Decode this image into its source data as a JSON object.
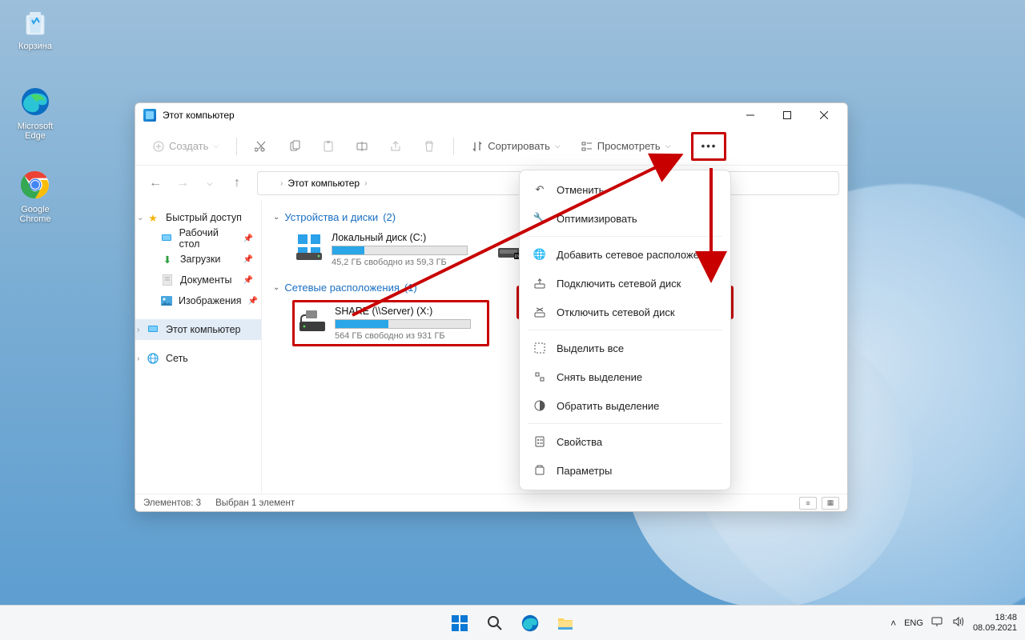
{
  "desktop": {
    "icons": [
      {
        "name": "recycle-bin",
        "label": "Корзина"
      },
      {
        "name": "edge",
        "label": "Microsoft Edge"
      },
      {
        "name": "chrome",
        "label": "Google Chrome"
      }
    ]
  },
  "window": {
    "title": "Этот компьютер",
    "toolbar": {
      "new": "Создать",
      "sort": "Сортировать",
      "view": "Просмотреть"
    },
    "breadcrumb": "Этот компьютер",
    "sidebar": {
      "quick": "Быстрый доступ",
      "desktop": "Рабочий стол",
      "downloads": "Загрузки",
      "documents": "Документы",
      "pictures": "Изображения",
      "thispc": "Этот компьютер",
      "network": "Сеть"
    },
    "groups": {
      "drives": {
        "title": "Устройства и диски",
        "count": "(2)"
      },
      "netloc": {
        "title": "Сетевые расположения",
        "count": "(1)"
      }
    },
    "drive_c": {
      "name": "Локальный диск (C:)",
      "free": "45,2 ГБ свободно из 59,3 ГБ",
      "fill_pct": 24
    },
    "drive_share": {
      "name": "SHARE (\\\\Server) (X:)",
      "free": "564 ГБ свободно из 931 ГБ",
      "fill_pct": 39
    },
    "status": {
      "items": "Элементов: 3",
      "selected": "Выбран 1 элемент"
    }
  },
  "ctxmenu": {
    "undo": "Отменить",
    "optimize": "Оптимизировать",
    "add_netloc": "Добавить сетевое расположение",
    "map_drive": "Подключить сетевой диск",
    "unmap_drive": "Отключить сетевой диск",
    "select_all": "Выделить все",
    "select_none": "Снять выделение",
    "invert_sel": "Обратить выделение",
    "properties": "Свойства",
    "options": "Параметры"
  },
  "taskbar": {
    "lang": "ENG",
    "time": "18:48",
    "date": "08.09.2021"
  }
}
